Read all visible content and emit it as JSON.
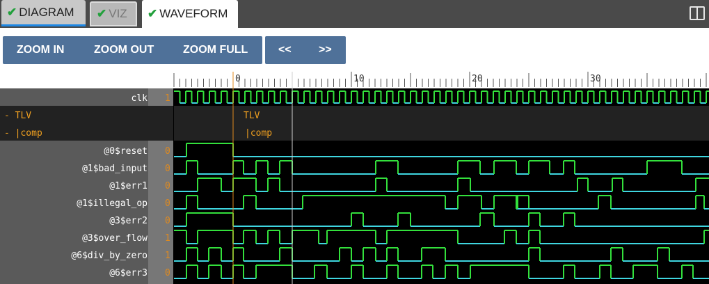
{
  "tabs": [
    {
      "label": "DIAGRAM",
      "checked": true
    },
    {
      "label": "VIZ",
      "checked": true
    },
    {
      "label": "WAVEFORM",
      "checked": true
    }
  ],
  "toolbar": {
    "zoom_in": "ZOOM IN",
    "zoom_out": "ZOOM OUT",
    "zoom_full": "ZOOM FULL",
    "prev": "<<",
    "next": ">>"
  },
  "ruler": {
    "labels": [
      "0",
      "10",
      "20",
      "30"
    ]
  },
  "scopes": [
    {
      "label": "- TLV",
      "wave_label": "TLV"
    },
    {
      "label": "-    |comp",
      "wave_label": "|comp"
    }
  ],
  "signals": [
    {
      "name": "clk",
      "value": "1"
    },
    {
      "name": "@0$reset",
      "value": "0"
    },
    {
      "name": "@1$bad_input",
      "value": "0"
    },
    {
      "name": "@1$err1",
      "value": "0"
    },
    {
      "name": "@1$illegal_op",
      "value": "0"
    },
    {
      "name": "@3$err2",
      "value": "0"
    },
    {
      "name": "@3$over_flow",
      "value": "1"
    },
    {
      "name": "@6$div_by_zero",
      "value": "1"
    },
    {
      "name": "@6$err3",
      "value": "0"
    }
  ],
  "colors": {
    "high": "#33e03c",
    "low": "#3fd6e0",
    "value_text": "#e08a1e",
    "scope_text": "#f0a020",
    "cursor": "#e08a1e"
  }
}
